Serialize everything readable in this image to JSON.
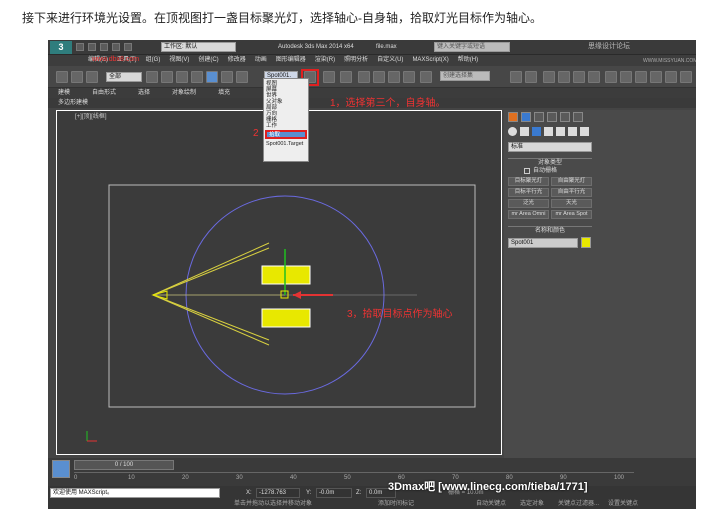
{
  "intro": "接下来进行环境光设置。在顶视图打一盏目标聚光灯，选择轴心-自身轴，拾取灯光目标作为轴心。",
  "title": {
    "app": "Autodesk 3ds Max  2014 x64",
    "file": "file.max",
    "workspace": "工作区: 默认",
    "search_placeholder": "键入关键字或短语",
    "logo": "3"
  },
  "menu": [
    "编辑(E)",
    "工具(T)",
    "组(G)",
    "视图(V)",
    "创建(C)",
    "修改器",
    "动画",
    "图形编辑器",
    "渲染(R)",
    "照明分析",
    "自定义(U)",
    "MAXScript(X)",
    "帮助(H)"
  ],
  "toolbar": {
    "filter": "全部",
    "refcoord": "Spot001.",
    "named_sel": "创建选择集"
  },
  "ribbon": [
    "建模",
    "自由形式",
    "选择",
    "对象绘制",
    "填充"
  ],
  "subribbon": "多边形建模",
  "viewport_label": "[+][顶][线框]",
  "dropdown": {
    "items": [
      "视图",
      "屏幕",
      "世界",
      "父对象",
      "局部",
      "万向",
      "栅格",
      "工作"
    ],
    "selected": "拾取",
    "footer": "Spot001.Target"
  },
  "annotations": {
    "a1": "1，选择第三个，自身轴。",
    "a2": "2",
    "a3": "3，拾取目标点作为轴心"
  },
  "cmd": {
    "category": "标准",
    "rollout_type": "对象类型",
    "autogrid": "自动栅格",
    "buttons": [
      "目标聚光灯",
      "自由聚光灯",
      "目标平行光",
      "自由平行光",
      "泛光",
      "天光",
      "mr Area Omni",
      "mr Area Spot"
    ],
    "rollout_name": "名称和颜色",
    "name": "Spot001"
  },
  "timeline": {
    "frame": "0 / 100",
    "ticks": [
      "0",
      "10",
      "20",
      "30",
      "40",
      "50",
      "60",
      "70",
      "80",
      "90",
      "100"
    ]
  },
  "status": {
    "maxscript": "欢迎使用  MAXScript。",
    "x_label": "X:",
    "x": "-1278.763",
    "y_label": "Y:",
    "y": "-0.0m",
    "z_label": "Z:",
    "z": "0.0m",
    "hint": "单击并拖动以选择并移动对象",
    "add_time": "添加时间标记",
    "grid": "栅格 = 10.0m",
    "autokey": "自动关键点",
    "set_key": "设置关键点",
    "filter": "关键点过滤器...",
    "selected": "选定对象"
  },
  "watermarks": {
    "w1": "思缘设计论坛",
    "w2": "WWW.MISSYUAN.COM",
    "w3": "www.dbx8.com",
    "bottom": "3Dmax吧  [www.linecg.com/tieba/1771]"
  },
  "colors": {
    "yellow": "#e8e800",
    "accent": "#1e6fc8",
    "red": "#e33333",
    "circle": "#6a6ae0"
  }
}
